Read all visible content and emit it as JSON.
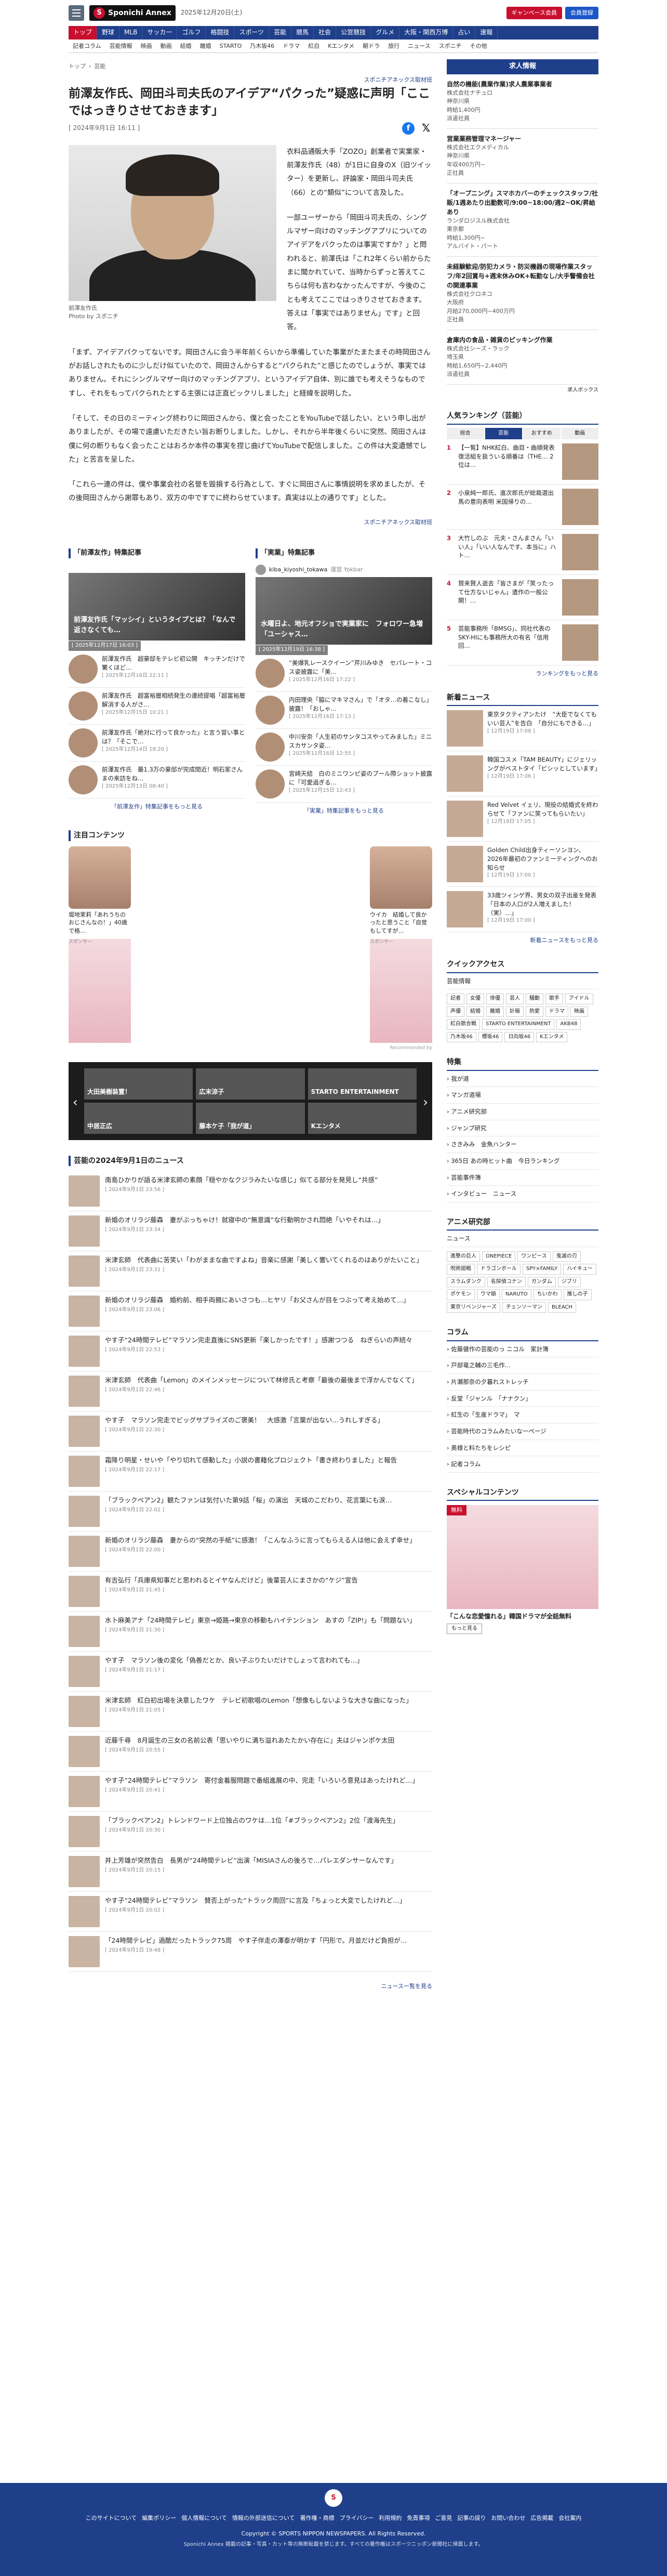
{
  "header": {
    "logo": "Sponichi Annex",
    "date": "2025年12月20日(土)",
    "btn_member": "ギャンベース会員",
    "btn_login": "会員登録",
    "nav": [
      "トップ",
      "野球",
      "MLB",
      "サッカー",
      "ゴルフ",
      "格闘技",
      "スポーツ",
      "芸能",
      "競馬",
      "社会",
      "公営競技",
      "グルメ",
      "大阪・関西万博",
      "占い",
      "速報"
    ],
    "subnav": [
      "記者コラム",
      "芸能情報",
      "映画",
      "動画",
      "結婚",
      "離婚",
      "STARTO",
      "乃木坂46",
      "ドラマ",
      "紅白",
      "Kエンタメ",
      "朝ドラ",
      "旅行",
      "ニュース",
      "スポニチ",
      "その他"
    ]
  },
  "breadcrumb": [
    "トップ",
    "芸能"
  ],
  "article": {
    "source": "スポニチアネックス取材班",
    "title": "前澤友作氏、岡田斗司夫氏のアイデア“パクった”疑惑に声明「ここではっきりさせておきます」",
    "date": "[ 2024年9月1日 16:11 ]",
    "caption": "前澤友作氏\nPhoto by スポニチ",
    "p1": "衣料品通販大手「ZOZO」創業者で実業家・前澤友作氏（48）が1日に自身のX（旧ツイッター）を更新し、評論家・岡田斗司夫氏（66）との“類似”について言及した。",
    "p2": "一部ユーザーから「岡田斗司夫氏の、シングルマザー向けのマッチングアプリについてのアイデアをパクったのは事実ですか？」と問われると、前澤氏は「これ2年くらい前からたまに聞かれていて、当時からずっと答えてこちらは何も言わなかったんですが、今後のことも考えてここではっきりさせておきます。答えは「事実ではありません」です」と回答。",
    "p3": "「まず、アイデアパクってないです。岡田さんに会う半年前くらいから準備していた事業がたまたまその時岡田さんがお話しされたものに少しだけ似ていたので、岡田さんからすると“パクられた”と感じたのでしょうが、事実ではありません。それにシングルマザー向けのマッチングアプリ、というアイデア自体、別に誰でも考えそうなものですし、それをもってパクられたとする主張には正直ビックリしました」と経緯を説明した。",
    "p4": "「そして、その日のミーティング終わりに岡田さんから、僕と会ったことをYouTubeで話したい、という申し出がありましたが、その場で遠慮いただきたい旨お断りしました。しかし、それから半年後くらいに突然、岡田さんは僕に何の断りもなく会ったことはおろか本件の事実を捏じ曲げてYouTubeで配信しました。この件は大変遺憾でした」と苦言を呈した。",
    "p5": "「これら一連の件は、僕や事業会社の名誉を毀損する行為として、すぐに岡田さんに事情説明を求めましたが、その後岡田さんから謝罪もあり、双方の中ですでに終わらせています。真実は以上の通りです」とした。",
    "source_bottom": "スポニチアネックス取材班"
  },
  "related": {
    "left": {
      "head": "「前澤友作」特集記事",
      "hero": "前澤友作氏「マッシイ」というタイプとは？「なんで返さなくても…",
      "hero_date": "[ 2025年12月17日 16:03 ]",
      "items": [
        {
          "t": "前澤友作氏　超豪邸をテレビ初公開　キッチンだけで驚くほど…",
          "d": "[ 2025年12月16日 22:11 ]"
        },
        {
          "t": "前澤友作氏　超富裕層相続発生の連続提唱「超富裕層解消する人がさ…",
          "d": "[ 2025年12月15日 10:21 ]"
        },
        {
          "t": "前澤友作氏「絶対に行って良かった」と言う冒い事とは？「そこで…",
          "d": "[ 2025年12月14日 18:20 ]"
        },
        {
          "t": "前澤友作氏　最1.3万の豪邸が完成間近！明石家さんまの来訪をね…",
          "d": "[ 2025年12月13日 08:40 ]"
        }
      ],
      "more": "「前澤友作」特集記事をもっと見る"
    },
    "right": {
      "head": "「実業」特集記事",
      "tw_user": "kiba_kiyoshi_tokawa",
      "tw_sub": "運営 Yokbar",
      "hero": "水曜日よ、地元オフショで実業家に　フォロワー急増「ユーシャス…",
      "hero_date": "[ 2025年12月19日 16:38 ]",
      "items": [
        {
          "t": "“美爆乳レースクイーン”芹川みゆき　セパレート・コス姿披露に「美…",
          "d": "[ 2025年12月16日 17:22 ]"
        },
        {
          "t": "内田理央「脇にマキマさん」で「オタ…の着こなし」披露！「おしゃ…",
          "d": "[ 2025年12月16日 17:13 ]"
        },
        {
          "t": "中川安奈「人生初のサンタコスやってみました」ミニスカサンタ姿…",
          "d": "[ 2025年12月16日 12:55 ]"
        },
        {
          "t": "宮崎天結　白のミニワンピ姿のプール際ショット披露に「可愛過ぎる…",
          "d": "[ 2025年12月15日 12:43 ]"
        }
      ],
      "more": "「実業」特集記事をもっと見る"
    }
  },
  "attention": {
    "head": "注目コンテンツ",
    "items": [
      {
        "t": "堀地茉莉「あれうちのおじさんなの！」40歳で格…",
        "d": "スポンサー"
      },
      {
        "t": "ウイカ　結婚して良かったと思うこと「自覚もしてすが…",
        "d": "スポンサー"
      }
    ],
    "powered": "Recommended by",
    "carousel": [
      "大田美樹装置！",
      "広末涼子",
      "STARTO ENTERTAINMENT",
      "中居正広",
      "藤本ケ子「我が道」",
      "Kエンタメ"
    ]
  },
  "newslist": {
    "head": "芸能の2024年9月1日のニュース",
    "items": [
      {
        "t": "南島ひかりが語る米津玄師の素顔「穏やかなクジラみたいな感じ」似てる部分を発見し“共感”",
        "d": "[ 2024年9月1日 23:56 ]"
      },
      {
        "t": "新婚のオリラジ藤森　妻がぶっちゃけ！就寝中の“無意識”な行動明かされ悶絶「いやそれは…」",
        "d": "[ 2024年9月1日 23:34 ]"
      },
      {
        "t": "米津玄師　代表曲に苦笑い「わがままな曲ですよね」音楽に感謝「美しく響いてくれるのはありがたいこと」",
        "d": "[ 2024年9月1日 23:31 ]"
      },
      {
        "t": "新婚のオリラジ藤森　婚約前、相手両親にあいさつも…ヒヤリ「お父さんが目をつぶって考え始めて…」",
        "d": "[ 2024年9月1日 23:06 ]"
      },
      {
        "t": "やす子“24時間テレビ”マラソン完走直後にSNS更新「楽しかったです！」感謝つつる　ねぎらいの声続々",
        "d": "[ 2024年9月1日 22:53 ]"
      },
      {
        "t": "米津玄師　代表曲「Lemon」のメインメッセージについて林修氏と考察「最後の最後まで浮かんでなくて」",
        "d": "[ 2024年9月1日 22:46 ]"
      },
      {
        "t": "やす子　マラソン完走でビッグサプライズのご褒美！　大感激「言葉が出ない…うれしすぎる」",
        "d": "[ 2024年9月1日 22:30 ]"
      },
      {
        "t": "霜降り明星・せいや「やり切れて感動した」小説の書籍化プロジェクト「書き終わりました」と報告",
        "d": "[ 2024年9月1日 22:17 ]"
      },
      {
        "t": "「ブラックペアン2」観たファンは気付いた第9話「桜」の演出　天城のこだわり、花言葉にも涙…",
        "d": "[ 2024年9月1日 22:02 ]"
      },
      {
        "t": "新婚のオリラジ藤森　妻からの“突然の手紙”に感激！「こんなふうに言ってもらえる人は他に会えず幸せ」",
        "d": "[ 2024年9月1日 22:00 ]"
      },
      {
        "t": "有吉弘行「兵庫県知事だと思われるとイヤなんだけど」後輩芸人にまさかの“ケジ”宣告",
        "d": "[ 2024年9月1日 21:45 ]"
      },
      {
        "t": "水卜麻美アナ「24時間テレビ」東京→姫路→東京の移動もハイテンション　あすの「ZIP!」も「問題ない」",
        "d": "[ 2024年9月1日 21:30 ]"
      },
      {
        "t": "やす子　マラソン後の変化「偽善だとか、良い子ぶりたいだけでしょって言われても…」",
        "d": "[ 2024年9月1日 21:17 ]"
      },
      {
        "t": "米津玄師　紅白初出場を決意したワケ　テレビ初歌唱のLemon「想像もしないような大きな曲になった」",
        "d": "[ 2024年9月1日 21:05 ]"
      },
      {
        "t": "近藤千尋　8月誕生の三女の名前公表「思いやりに満ち溢れあたたかい存在に」夫はジャンポケ太田",
        "d": "[ 2024年9月1日 20:55 ]"
      },
      {
        "t": "やす子“24時間テレビ”マラソン　寄付金着服問題で番組進展の中、完走「いろいろ意見はあったけれど…」",
        "d": "[ 2024年9月1日 20:41 ]"
      },
      {
        "t": "「ブラックペアン2」トレンドワード上位独占のワケは…1位「#ブラックペアン2」2位「渡海先生」",
        "d": "[ 2024年9月1日 20:30 ]"
      },
      {
        "t": "井上芳雄が突然告白　長男が“24時間テレビ”出演「MISIAさんの後ろで…パレエダンサーなんです」",
        "d": "[ 2024年9月1日 20:15 ]"
      },
      {
        "t": "やす子“24時間テレビ”マラソン　賛否上がった“トラック周回”に言及「ちょっと大変でしたけれど…」",
        "d": "[ 2024年9月1日 20:02 ]"
      },
      {
        "t": "「24時間テレビ」過酷だったトラック75周　やす子伴走の澤泰が明かす「円形で。月並だけど負担が…",
        "d": "[ 2024年9月1日 19:48 ]"
      }
    ],
    "more": "ニュース一覧を見る"
  },
  "side": {
    "jobs_head": "求人情報",
    "jobs": [
      {
        "t": "自然の機能(農業作業)求人農業事業者",
        "c": "株式会社ナチュロ",
        "l": "神奈川県",
        "p": "時給1,400円",
        "e": "派遣社員"
      },
      {
        "t": "営業業務管理マネージャー",
        "c": "株式会社エクメディカル",
        "l": "神奈川県",
        "p": "年収400万円~",
        "e": "正社員"
      },
      {
        "t": "「オープニング」スマホカバーのチェックスタッフ/社販/1週あたり出勤数可/9:00~18:00/週2~OK/昇給あり",
        "c": "ランダロジスル株式会社",
        "l": "東京都",
        "p": "時給1,300円~",
        "e": "アルバイト・パート"
      },
      {
        "t": "未経験歓迎/防犯カメラ・防災機器の現場作業スタッフ/年2回賞与+週末休みOK+転勤なし/大手警備会社の関連事業",
        "c": "株式会社クロネコ",
        "l": "大阪府",
        "p": "月給270,000円~400万円",
        "e": "正社員"
      },
      {
        "t": "倉庫内の食品・雑貨のピッキング作業",
        "c": "株式会社シーズ・ラック",
        "l": "埼玉県",
        "p": "時給1,650円~2,440円",
        "e": "派遣社員"
      }
    ],
    "jobs_powered": "求人ボックス",
    "ranking_head": "人気ランキング（芸能）",
    "ranking_tabs": [
      "総合",
      "芸能",
      "おすすめ",
      "動画"
    ],
    "ranking": [
      {
        "n": "1",
        "t": "【一覧】NHK紅白、曲目・曲順発表　復活組を扱ういる順番は（THE… 2位は…"
      },
      {
        "n": "2",
        "t": "小泉純一郎氏、進次郎氏が総裁選出馬の意向表明 米国帰りの…"
      },
      {
        "n": "3",
        "t": "大竹しのぶ　元夫・さんまさん「いい人」「いい人なんです、本当に」ハト…"
      },
      {
        "n": "4",
        "t": "賀来賢人逝去「皆さまが「笑ったって仕方ないじゃん」遺作の一般公開！…"
      },
      {
        "n": "5",
        "t": "芸能事務所「BMSG」、同社代表のSKY-HIにも事務所大の有名「信用回…"
      }
    ],
    "ranking_more": "ランキングをもっと見る",
    "new_head": "新着ニュース",
    "new": [
      {
        "t": "東京タクティアンたけ　“大臣でなくてもいい芸人”を告白　「自分にもできる…」",
        "d": "[ 12月19日 17:08 ]"
      },
      {
        "t": "韓国コスメ「TAM BEAUTY」にジェリッングがベストタイ「ビシッとしています」",
        "d": "[ 12月19日 17:06 ]"
      },
      {
        "t": "Red Velvet イェリ、現役の結婚式を終わらせて「ファンに笑ってもらいたい」",
        "d": "[ 12月19日 17:05 ]"
      },
      {
        "t": "Golden Child出身ティーソンヨン、2026年最初のファンミーティングへのお知らせ",
        "d": "[ 12月19日 17:00 ]"
      },
      {
        "t": "33歳ツィンゲ界、男女の双子出産を発表「日本の人口が2人増えました！（実）…」",
        "d": "[ 12月19日 17:00 ]"
      }
    ],
    "new_more": "新着ニュースをもっと見る",
    "quick_head": "クイックアクセス",
    "quick_sub": "芸能情報",
    "quick_chips": [
      "記者",
      "女優",
      "俳優",
      "芸人",
      "騒動",
      "歌手",
      "アイドル",
      "声優",
      "結婚",
      "離婚",
      "訃報",
      "熱愛",
      "ドラマ",
      "映画",
      "紅白歌合戦",
      "STARTO ENTERTAINMENT",
      "AKB48",
      "乃木坂46",
      "櫻坂46",
      "日向坂46",
      "Kエンタメ"
    ],
    "special_head": "特集",
    "special": [
      "我が道",
      "マンガ道場",
      "アニメ研究部",
      "ジャンプ研究",
      "さきみみ　金魚ハンター",
      "365日 あの時ヒット曲　今日ランキング",
      "芸能事件簿",
      "インタビュー　ニュース"
    ],
    "anime_head": "アニメ研究部",
    "anime_sub": "ニュース",
    "anime_chips": [
      "進撃の巨人",
      "ONEPIECE",
      "ワンピース",
      "鬼滅の刃",
      "呪術廻戦",
      "ドラゴンボール",
      "SPY×FAMILY",
      "ハイキュー",
      "スラムダンク",
      "名探偵コナン",
      "ガンダム",
      "ジブリ",
      "ポケモン",
      "ウマ娘",
      "NARUTO",
      "ちいかわ",
      "推しの子",
      "東京リベンジャーズ",
      "チェンソーマン",
      "BLEACH"
    ],
    "column_head": "コラム",
    "columns": [
      "佐藤健作の芸能のっ ニコル　家計簿",
      "戸部竜之輔の三毛作…",
      "片瀬那奈の夕暮れストレッチ",
      "反堂「ジャンル　「ナナクン」",
      "紅生の「生産ドラマ」　マ",
      "芸能時代のコラムみたいな一ページ",
      "奥様と料たちをレシピ",
      "記者コラム"
    ],
    "sponsor_head": "スペシャルコンテンツ",
    "sponsor_label": "無料",
    "sponsor_t": "「こんな恋愛憧れる」韓国ドラマが全話無料",
    "sponsor_btn": "もっと見る"
  },
  "footer": {
    "logo": "S",
    "links": [
      "このサイトについて",
      "編集ポリシー",
      "個人情報について",
      "情報の外部送信について",
      "著作権・商標",
      "プライバシー",
      "利用規約",
      "免責事項",
      "ご意見",
      "記事の誤り",
      "お問い合わせ",
      "広告掲載",
      "会社案内"
    ],
    "copyright": "Copyright © SPORTS NIPPON NEWSPAPERS. All Rights Reserved.",
    "note": "Sponichi Annex 掲載の記事・写真・カット等の無断転載を禁じます。すべての著作権はスポーツニッポン新聞社に帰属します。"
  }
}
